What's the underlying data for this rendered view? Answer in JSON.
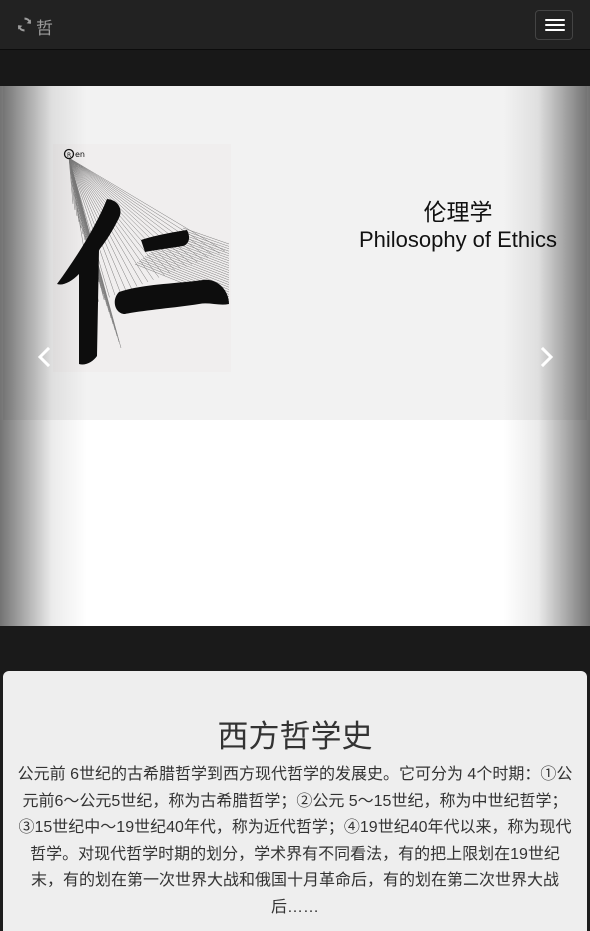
{
  "navbar": {
    "brand_icon": "refresh-icon",
    "brand_text": "哲",
    "menu_icon": "hamburger-menu-icon"
  },
  "carousel": {
    "slide": {
      "image": "ren-calligraphy-logo",
      "image_mark": "Ren",
      "title_cn": "伦理学",
      "title_en": "Philosophy of Ethics"
    },
    "prev_icon": "chevron-left-icon",
    "next_icon": "chevron-right-icon"
  },
  "panel": {
    "heading": "西方哲学史",
    "body": "公元前 6世纪的古希腊哲学到西方现代哲学的发展史。它可分为 4个时期：①公元前6～公元5世纪，称为古希腊哲学；②公元 5～15世纪，称为中世纪哲学；③15世纪中～19世纪40年代，称为近代哲学；④19世纪40年代以来，称为现代哲学。对现代哲学时期的划分，学术界有不同看法，有的把上限划在19世纪末，有的划在第一次世界大战和俄国十月革命后，有的划在第二次世界大战后……"
  },
  "colors": {
    "navbar_bg": "#222222",
    "page_bg": "#1c1c1c",
    "panel_bg": "#eeeeee",
    "slide_bg": "#f2f2f2"
  }
}
